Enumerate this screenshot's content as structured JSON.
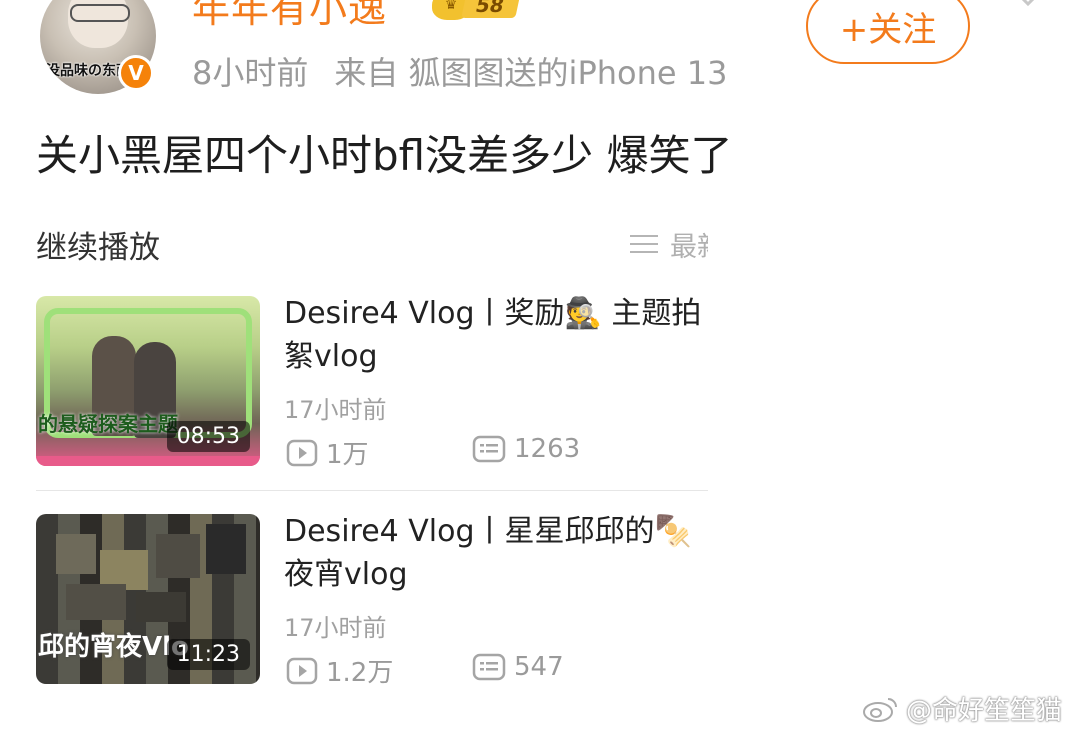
{
  "header": {
    "username": "年年有小逸",
    "level": "58",
    "avatar_sticker_text": "没品味の东西!",
    "time_ago": "8小时前",
    "source": "来自 狐图图送的iPhone 13",
    "verified_badge": "V",
    "follow_label": "+关注"
  },
  "post": {
    "text": "关小黑屋四个小时bfl没差多少 爆笑了"
  },
  "playlist": {
    "section_title": "继续播放",
    "sort_label": "最新",
    "videos": [
      {
        "title_line1": "Desire4 Vlog丨奖励🕵 主题拍",
        "title_line2": "絮vlog",
        "duration": "08:53",
        "time_ago": "17小时前",
        "plays": "1万",
        "comments": "1263",
        "thumb_caption": "的悬疑探案主题"
      },
      {
        "title_line1": "Desire4 Vlog丨星星邱邱的🍢",
        "title_line2": "夜宵vlog",
        "duration": "11:23",
        "time_ago": "17小时前",
        "plays": "1.2万",
        "comments": "547",
        "thumb_caption": "邱的宵夜Vlo"
      }
    ]
  },
  "watermark": {
    "text": "@命好笙笙猫"
  },
  "colors": {
    "accent": "#f37b1c",
    "meta_gray": "#9a9a9a",
    "text": "#222222"
  }
}
